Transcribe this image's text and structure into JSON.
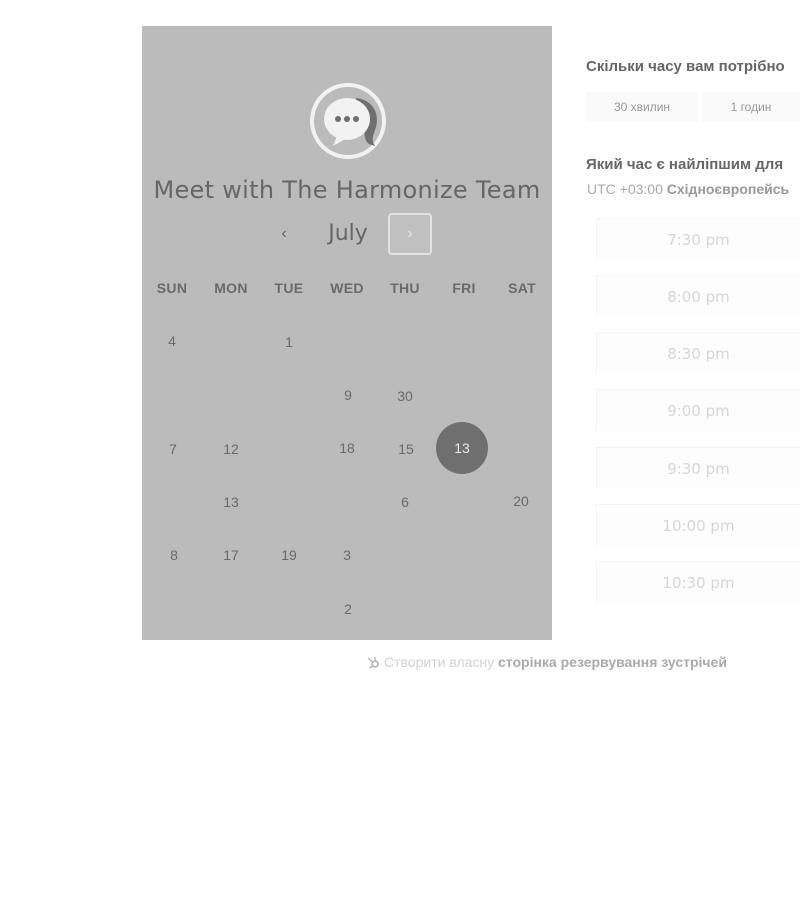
{
  "calendar": {
    "title": "Meet with The Harmonize Team",
    "month": "July",
    "prev_symbol": "‹",
    "next_symbol": "›",
    "weekdays": [
      "SUN",
      "MON",
      "TUE",
      "WED",
      "THU",
      "FRI",
      "SAT"
    ],
    "days": [
      "4",
      "1",
      "9",
      "30",
      "7",
      "12",
      "18",
      "15",
      "13",
      "13",
      "6",
      "20",
      "8",
      "17",
      "19",
      "3",
      "2"
    ],
    "selected_day": "13",
    "colors": {
      "panel": "#bbbbbb",
      "selected": "#6f6f6f"
    }
  },
  "duration": {
    "question": "Скільки часу вам потрібно",
    "options": [
      "30 хвилин",
      "1 годин"
    ]
  },
  "times": {
    "question": "Який час є найліпшим для",
    "timezone_offset": "UTC +03:00",
    "timezone_name": "Східноєвропейсь",
    "slots": [
      "7:30 pm",
      "8:00 pm",
      "8:30 pm",
      "9:00 pm",
      "9:30 pm",
      "10:00 pm",
      "10:30 pm"
    ]
  },
  "footer": {
    "plain_text": "Створити власну",
    "link_text": "сторінка резервування зустрічей",
    "icon": "hubspot-sprocket-icon"
  }
}
